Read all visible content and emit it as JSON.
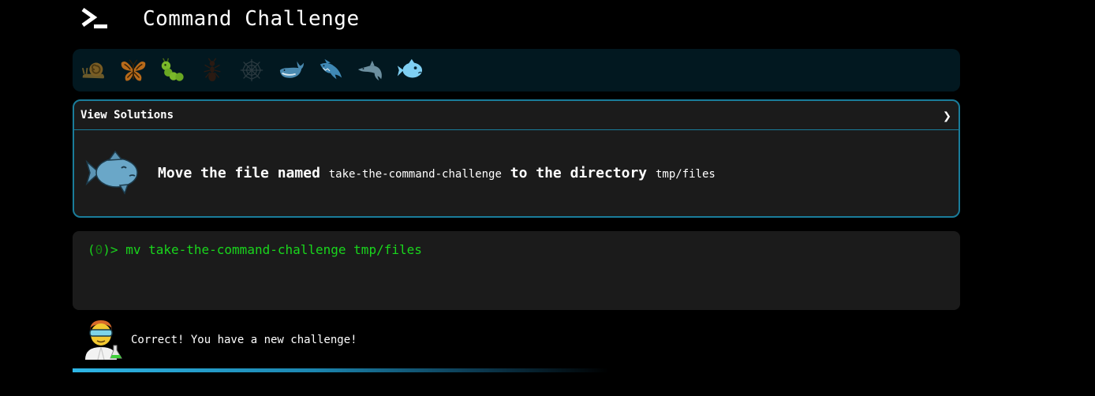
{
  "header": {
    "title": "Command Challenge",
    "logo_icon": "terminal-prompt-icon"
  },
  "levels": [
    {
      "name": "snail",
      "icon": "snail-icon"
    },
    {
      "name": "butterfly",
      "icon": "butterfly-icon"
    },
    {
      "name": "caterpillar",
      "icon": "caterpillar-icon"
    },
    {
      "name": "ant",
      "icon": "ant-icon"
    },
    {
      "name": "spider-web",
      "icon": "spider-web-icon"
    },
    {
      "name": "whale",
      "icon": "whale-icon"
    },
    {
      "name": "shark",
      "icon": "shark-icon"
    },
    {
      "name": "dolphin",
      "icon": "dolphin-icon"
    },
    {
      "name": "fish",
      "icon": "fish-icon",
      "active": true
    }
  ],
  "challenge": {
    "solutions_label": "View Solutions",
    "chevron": "❯",
    "text_move": "Move the file named ",
    "file_name": "take-the-command-challenge",
    "text_to": " to the directory ",
    "dir_name": "tmp/files"
  },
  "terminal": {
    "prompt_open": "(",
    "prompt_count": "0",
    "prompt_close": ")> ",
    "command": "mv take-the-command-challenge tmp/files"
  },
  "feedback": {
    "text": "Correct! You have a new challenge!"
  },
  "colors": {
    "accent": "#1a7c9a",
    "terminal_green": "#19d61c",
    "active_level": "#7fcff2",
    "panel_bg": "#1b1b1b"
  }
}
